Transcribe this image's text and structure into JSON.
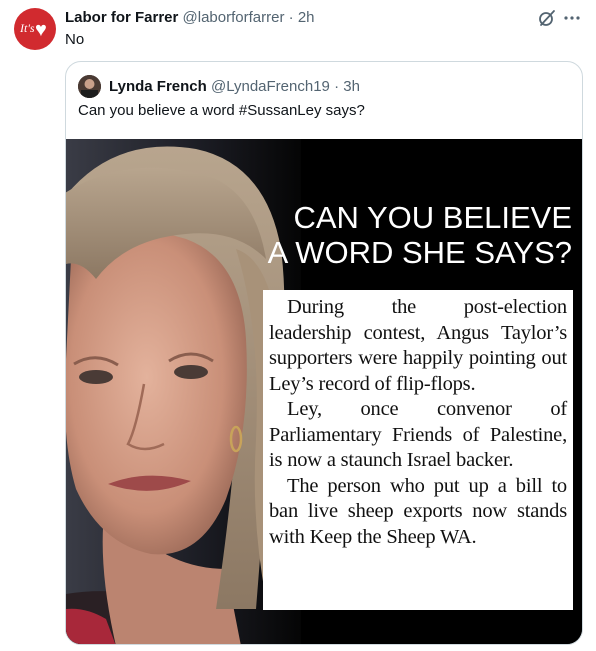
{
  "tweet": {
    "author_name": "Labor for Farrer",
    "handle": "@laborforfarrer",
    "separator": "·",
    "time": "2h",
    "text": "No",
    "avatar_text": "It's",
    "avatar_color": "#d12a2f"
  },
  "quote": {
    "author_name": "Lynda French",
    "handle": "@LyndaFrench19",
    "separator": "·",
    "time": "3h",
    "text": "Can you believe a word #SussanLey says?",
    "image": {
      "headline_line1": "CAN YOU BELIEVE",
      "headline_line2": "A WORD SHE SAYS?",
      "paragraphs": [
        "During the post-election leadership contest, Angus Taylor’s supporters were happily pointing out Ley’s record of flip-flops.",
        "Ley, once convenor of Parliamentary Friends of Palestine, is now a staunch Israel backer.",
        "The person who put up a bill to ban live sheep exports now stands with Keep the Sheep WA."
      ]
    }
  },
  "icons": {
    "grok": "grok-icon",
    "more": "more-options-icon"
  }
}
